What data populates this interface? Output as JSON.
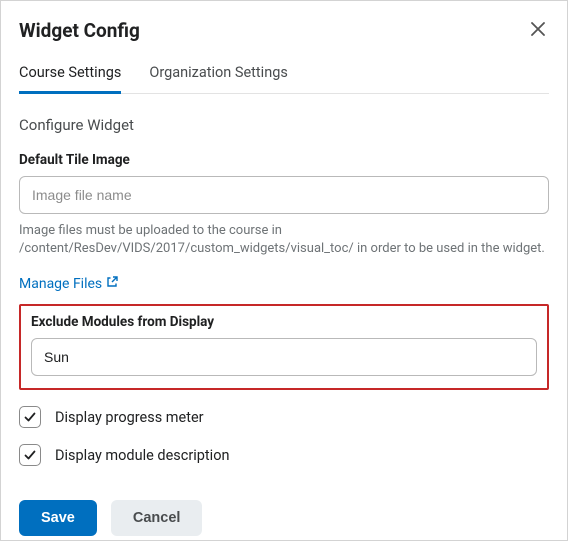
{
  "dialog": {
    "title": "Widget Config"
  },
  "tabs": {
    "course": "Course Settings",
    "org": "Organization Settings"
  },
  "section": {
    "heading": "Configure Widget"
  },
  "default_tile": {
    "label": "Default Tile Image",
    "placeholder": "Image file name",
    "value": "",
    "help": "Image files must be uploaded to the course in /content/ResDev/VIDS/2017/custom_widgets/visual_toc/ in order to be used in the widget."
  },
  "manage_files": {
    "label": "Manage Files"
  },
  "exclude": {
    "label": "Exclude Modules from Display",
    "value": "Sun"
  },
  "checkboxes": {
    "progress": "Display progress meter",
    "description": "Display module description"
  },
  "buttons": {
    "save": "Save",
    "cancel": "Cancel"
  }
}
